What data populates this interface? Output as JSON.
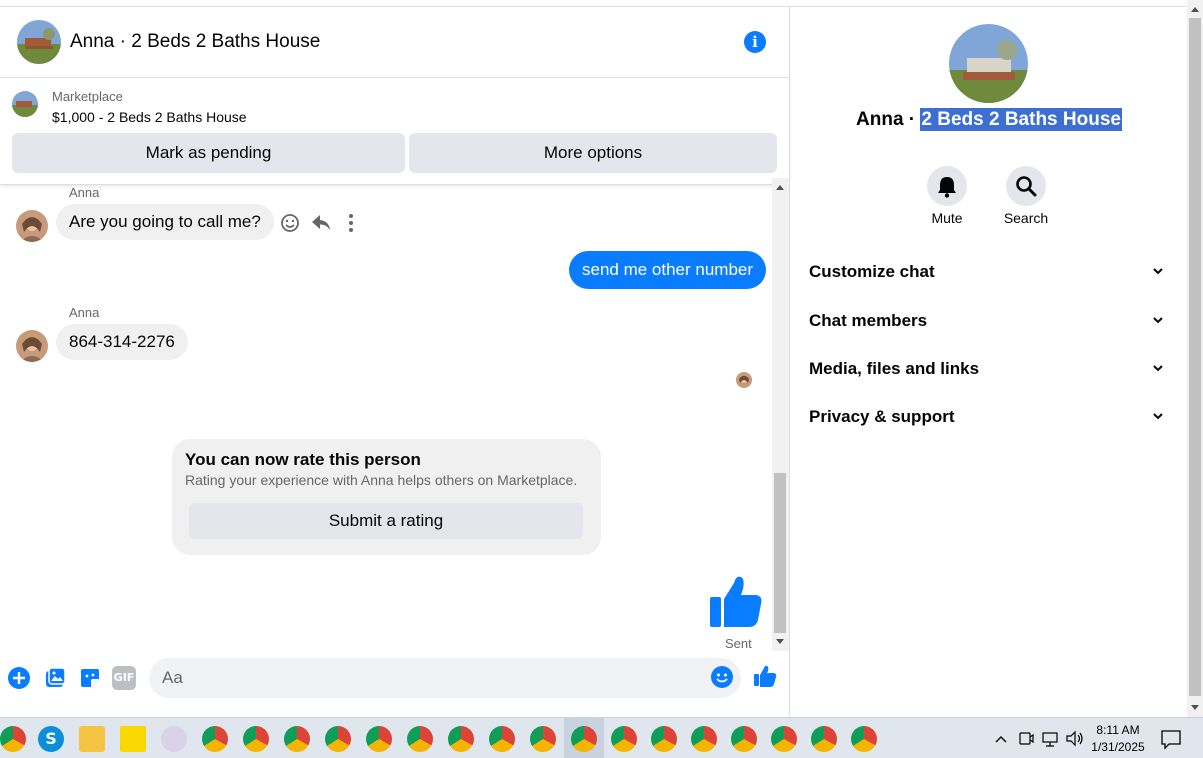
{
  "header": {
    "title": "Anna · 2 Beds 2 Baths House",
    "info_icon": "info-icon"
  },
  "marketplace": {
    "label": "Marketplace",
    "listing": "$1,000 - 2 Beds 2 Baths House",
    "mark_pending": "Mark as pending",
    "more_options": "More options"
  },
  "messages": [
    {
      "sender": "Anna",
      "text": "Are you going to call me?",
      "direction": "in"
    },
    {
      "text": "send me other number",
      "direction": "out"
    },
    {
      "sender": "Anna",
      "text": "864-314-2276",
      "direction": "in"
    }
  ],
  "rating_card": {
    "title": "You can now rate this person",
    "subtitle": "Rating your experience with Anna helps others on Marketplace.",
    "button": "Submit a rating"
  },
  "status": {
    "sent": "Sent"
  },
  "composer": {
    "placeholder": "Aa",
    "icons": [
      "plus-icon",
      "photo-icon",
      "sticker-icon",
      "gif-icon",
      "emoji-icon",
      "like-icon"
    ],
    "gif_label": "GIF"
  },
  "panel": {
    "name_prefix": "Anna · ",
    "name_highlight": "2 Beds 2 Baths House",
    "mute": "Mute",
    "search": "Search",
    "sections": [
      "Customize chat",
      "Chat members",
      "Media, files and links",
      "Privacy & support"
    ]
  },
  "taskbar": {
    "time": "8:11 AM",
    "date": "1/31/2025"
  },
  "colors": {
    "accent": "#0a7cff",
    "bubble_in": "#f0f0f0",
    "button_grey": "#e4e6eb",
    "selection": "#3c6fd1"
  }
}
